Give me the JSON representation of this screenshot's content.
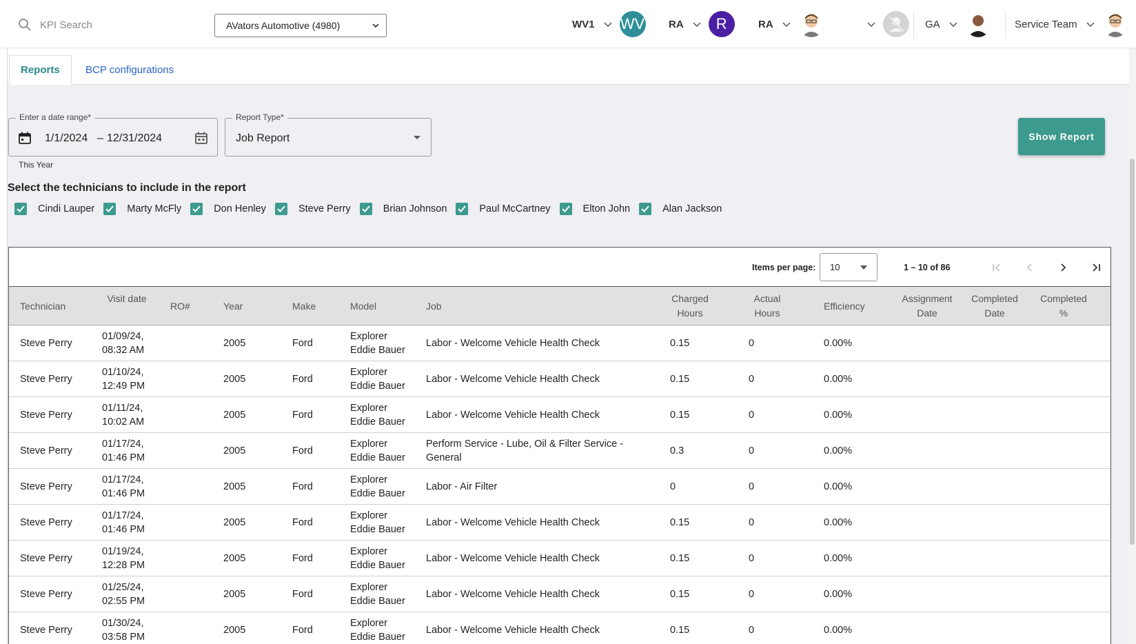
{
  "header": {
    "search": {
      "placeholder": "KPI Search"
    },
    "dealer": "AVators Automotive (4980)",
    "accounts": [
      {
        "code": "WV1",
        "avatar_text": "WV",
        "avatar_color": "#2e8f99"
      },
      {
        "code": "RA",
        "avatar_text": "R",
        "avatar_color": "#4a1fa3"
      },
      {
        "code": "RA",
        "avatar_text": "",
        "avatar_color": ""
      },
      {
        "code": "",
        "avatar_text": "",
        "avatar_color": "#d4d4d4"
      },
      {
        "code": "GA",
        "avatar_text": "",
        "avatar_color": ""
      },
      {
        "code": "Service Team",
        "avatar_text": "",
        "avatar_color": ""
      }
    ]
  },
  "tabs": [
    {
      "label": "Reports",
      "active": true
    },
    {
      "label": "BCP configurations",
      "active": false
    }
  ],
  "filters": {
    "date_range_label": "Enter a date range*",
    "date_start": "1/1/2024",
    "date_sep": "–",
    "date_end": "12/31/2024",
    "date_hint": "This Year",
    "report_type_label": "Report Type*",
    "report_type_value": "Job Report",
    "show_report_label": "Show Report"
  },
  "technicians": {
    "title": "Select the technicians to include in the report",
    "items": [
      {
        "name": "Cindi Lauper",
        "checked": true
      },
      {
        "name": "Marty McFly",
        "checked": true
      },
      {
        "name": "Don Henley",
        "checked": true
      },
      {
        "name": "Steve Perry",
        "checked": true
      },
      {
        "name": "Brian Johnson",
        "checked": true
      },
      {
        "name": "Paul McCartney",
        "checked": true
      },
      {
        "name": "Elton John",
        "checked": true
      },
      {
        "name": "Alan Jackson",
        "checked": true
      }
    ]
  },
  "paginator": {
    "items_per_page_label": "Items per page:",
    "items_per_page": "10",
    "range": "1 – 10 of 86"
  },
  "table": {
    "columns": [
      "Technician",
      "Visit date",
      "RO#",
      "Year",
      "Make",
      "Model",
      "Job",
      "Charged Hours",
      "Actual Hours",
      "Efficiency",
      "Assignment Date",
      "Completed Date",
      "Completed %"
    ],
    "rows": [
      {
        "technician": "Steve Perry",
        "visit_date": "01/09/24, 08:32 AM",
        "ro": "",
        "year": "2005",
        "make": "Ford",
        "model": "Explorer Eddie Bauer",
        "job": "Labor - Welcome Vehicle Health Check",
        "charged": "0.15",
        "actual": "0",
        "efficiency": "0.00%"
      },
      {
        "technician": "Steve Perry",
        "visit_date": "01/10/24, 12:49 PM",
        "ro": "",
        "year": "2005",
        "make": "Ford",
        "model": "Explorer Eddie Bauer",
        "job": "Labor - Welcome Vehicle Health Check",
        "charged": "0.15",
        "actual": "0",
        "efficiency": "0.00%"
      },
      {
        "technician": "Steve Perry",
        "visit_date": "01/11/24, 10:02 AM",
        "ro": "",
        "year": "2005",
        "make": "Ford",
        "model": "Explorer Eddie Bauer",
        "job": "Labor - Welcome Vehicle Health Check",
        "charged": "0.15",
        "actual": "0",
        "efficiency": "0.00%"
      },
      {
        "technician": "Steve Perry",
        "visit_date": "01/17/24, 01:46 PM",
        "ro": "",
        "year": "2005",
        "make": "Ford",
        "model": "Explorer Eddie Bauer",
        "job": "Perform Service - Lube, Oil & Filter Service - General",
        "charged": "0.3",
        "actual": "0",
        "efficiency": "0.00%"
      },
      {
        "technician": "Steve Perry",
        "visit_date": "01/17/24, 01:46 PM",
        "ro": "",
        "year": "2005",
        "make": "Ford",
        "model": "Explorer Eddie Bauer",
        "job": "Labor - Air Filter",
        "charged": "0",
        "actual": "0",
        "efficiency": "0.00%"
      },
      {
        "technician": "Steve Perry",
        "visit_date": "01/17/24, 01:46 PM",
        "ro": "",
        "year": "2005",
        "make": "Ford",
        "model": "Explorer Eddie Bauer",
        "job": "Labor - Welcome Vehicle Health Check",
        "charged": "0.15",
        "actual": "0",
        "efficiency": "0.00%"
      },
      {
        "technician": "Steve Perry",
        "visit_date": "01/19/24, 12:28 PM",
        "ro": "",
        "year": "2005",
        "make": "Ford",
        "model": "Explorer Eddie Bauer",
        "job": "Labor - Welcome Vehicle Health Check",
        "charged": "0.15",
        "actual": "0",
        "efficiency": "0.00%"
      },
      {
        "technician": "Steve Perry",
        "visit_date": "01/25/24, 02:55 PM",
        "ro": "",
        "year": "2005",
        "make": "Ford",
        "model": "Explorer Eddie Bauer",
        "job": "Labor - Welcome Vehicle Health Check",
        "charged": "0.15",
        "actual": "0",
        "efficiency": "0.00%"
      },
      {
        "technician": "Steve Perry",
        "visit_date": "01/30/24, 03:58 PM",
        "ro": "",
        "year": "2005",
        "make": "Ford",
        "model": "Explorer Eddie Bauer",
        "job": "Labor - Welcome Vehicle Health Check",
        "charged": "0.15",
        "actual": "0",
        "efficiency": "0.00%"
      }
    ]
  },
  "colors": {
    "accent": "#3d9a8e",
    "link": "#2a64c5",
    "tab_active": "#2a8a8f"
  }
}
